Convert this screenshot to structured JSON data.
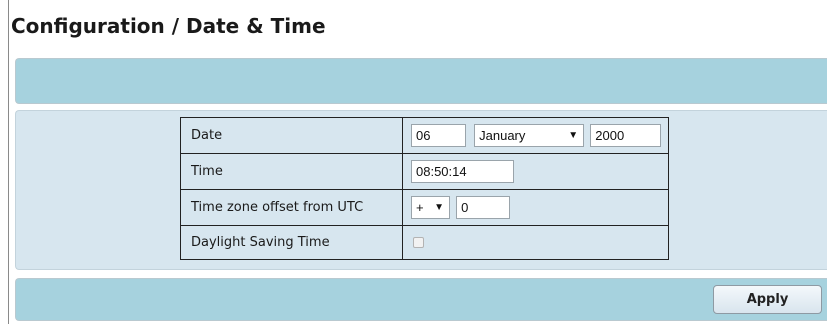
{
  "page": {
    "title": "Configuration / Date & Time"
  },
  "form": {
    "rows": [
      {
        "label": "Date"
      },
      {
        "label": "Time"
      },
      {
        "label": "Time zone offset from UTC"
      },
      {
        "label": "Daylight Saving Time"
      }
    ],
    "date": {
      "day": "06",
      "month": "January",
      "year": "2000"
    },
    "time": {
      "value": "08:50:14"
    },
    "timezone": {
      "sign": "+",
      "offset": "0"
    },
    "dst": {
      "checked": false
    }
  },
  "actions": {
    "apply_label": "Apply"
  },
  "icons": {
    "dropdown": "chevron-down-icon",
    "dst_toggle": "checkbox-icon"
  }
}
